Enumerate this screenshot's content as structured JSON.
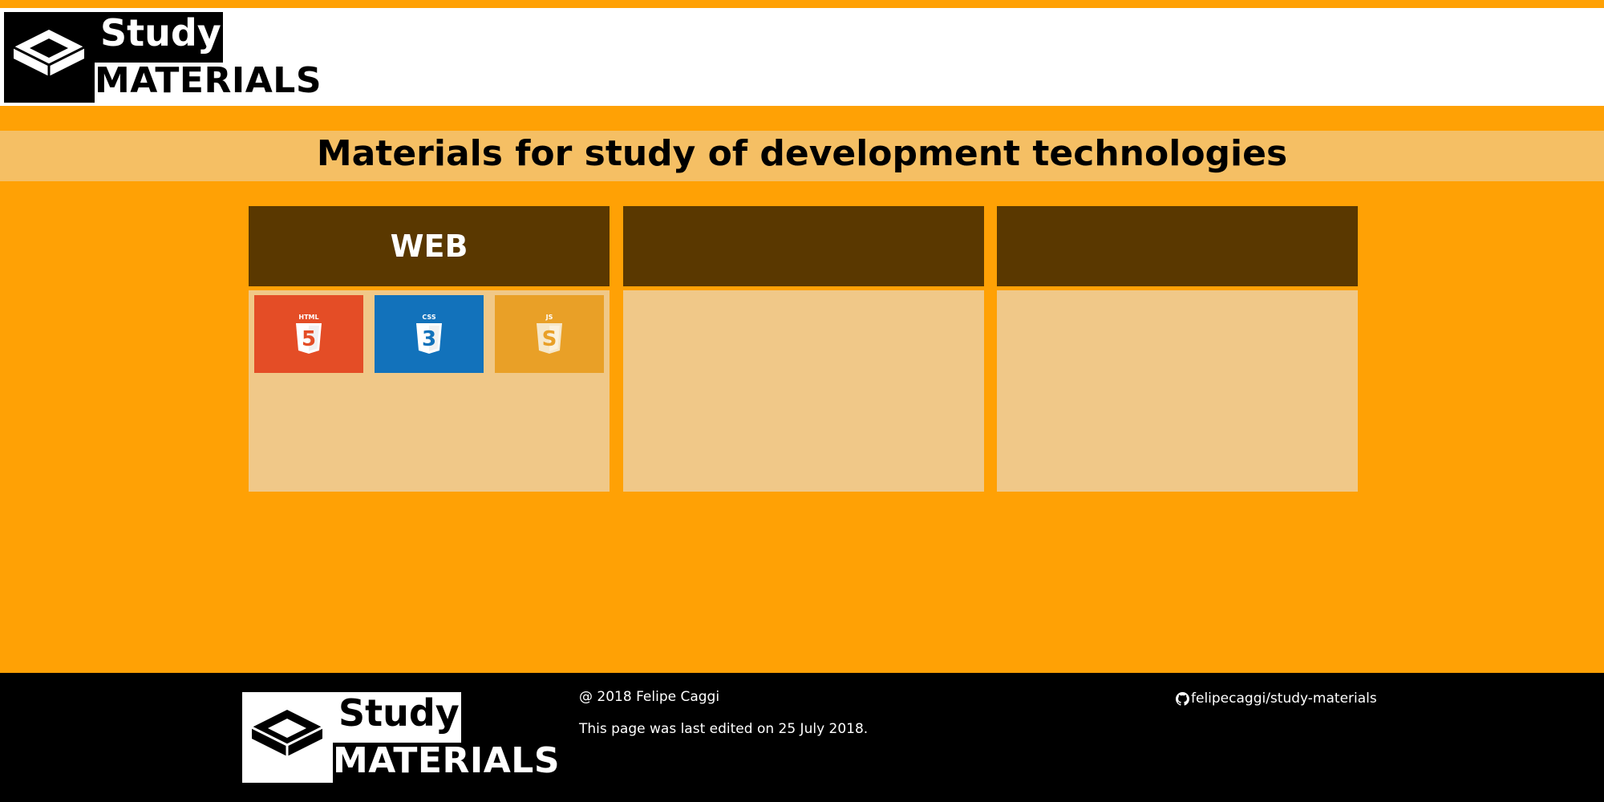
{
  "header": {
    "logo": {
      "word1": "Study",
      "word2": "MATERIALS"
    }
  },
  "banner": {
    "title": "Materials for study of development technologies"
  },
  "cards": [
    {
      "title": "WEB",
      "tiles": [
        {
          "name": "HTML5",
          "label": "HTML",
          "digit": "5",
          "color": "#E44D26"
        },
        {
          "name": "CSS3",
          "label": "CSS",
          "digit": "3",
          "color": "#1272BB"
        },
        {
          "name": "JavaScript",
          "label": "JS",
          "digit": "S",
          "color": "#E9A027"
        }
      ]
    },
    {
      "title": "",
      "tiles": []
    },
    {
      "title": "",
      "tiles": []
    }
  ],
  "footer": {
    "logo": {
      "word1": "Study",
      "word2": "MATERIALS"
    },
    "copyright": "@ 2018 Felipe Caggi",
    "last_edited": "This page was last edited on 25 July 2018.",
    "repo_link": "felipecaggi/study-materials",
    "repo_icon": "github-icon"
  },
  "colors": {
    "page_bg": "#FFA105",
    "banner_bg": "#F5BF64",
    "card_head": "#5A3800",
    "card_body": "#F0C888",
    "footer_bg": "#000000"
  }
}
